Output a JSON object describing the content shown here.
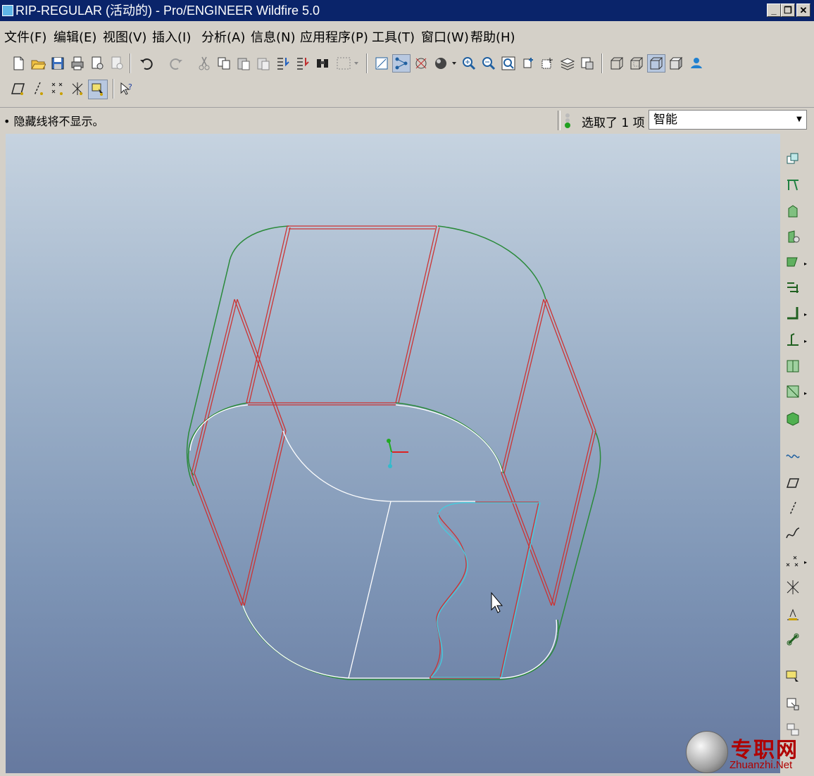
{
  "window": {
    "title": "RIP-REGULAR (活动的) - Pro/ENGINEER Wildfire 5.0",
    "minimize": "_",
    "restore": "❐",
    "close": "✕"
  },
  "menu": [
    {
      "label": "文件(F)"
    },
    {
      "label": "编辑(E)"
    },
    {
      "label": "视图(V)"
    },
    {
      "label": "插入(I)"
    },
    {
      "label": "分析(A)"
    },
    {
      "label": "信息(N)"
    },
    {
      "label": "应用程序(P)"
    },
    {
      "label": "工具(T)"
    },
    {
      "label": "窗口(W)"
    },
    {
      "label": "帮助(H)"
    }
  ],
  "message_bar": {
    "message": "• 隐藏线将不显示。",
    "selection_count_text": "选取了 1 项",
    "filter_value": "智能"
  },
  "toolbar_icons_row1": [
    "new-icon",
    "open-icon",
    "save-icon",
    "print-icon",
    "send-mail-icon",
    "send-icon",
    "undo-icon",
    "redo-icon",
    "cut-icon",
    "copy-icon",
    "paste-icon",
    "paste-special-icon",
    "regenerate-icon",
    "regen-manager-icon",
    "find-icon",
    "select-box-icon",
    "datum-display-icon",
    "network-icon",
    "spin-center-icon",
    "shading-icon",
    "zoom-in-icon",
    "zoom-out-icon",
    "refit-icon",
    "reorient-icon",
    "saved-views-icon",
    "layers-icon",
    "view-manager-icon",
    "wireframe-icon",
    "hidden-line-icon",
    "no-hidden-icon",
    "shaded-icon",
    "enhanced-realism-icon"
  ],
  "toolbar_icons_row2": [
    "datum-planes-icon",
    "datum-axes-icon",
    "datum-points-icon",
    "csys-icon",
    "annotations-icon",
    "context-help-icon"
  ],
  "right_toolbar_icons": [
    "assemble-icon",
    "datum-plane-tool-icon",
    "extrude-icon",
    "revolve-icon",
    "sweep-icon",
    "sweep-blend-icon",
    "hole-icon",
    "round-icon",
    "chamfer-icon",
    "draft-icon",
    "shell-icon",
    "rib-icon",
    "sketch-icon",
    "plane-icon",
    "axis-icon",
    "curve-icon",
    "point-icon",
    "csys-tool-icon",
    "analysis-icon",
    "mirror-icon",
    "annotation-feature-icon",
    "group-icon",
    "copy-paste-icon"
  ],
  "watermark": {
    "cn": "专职网",
    "en": "Zhuanzhi.Net"
  },
  "colors": {
    "titlebar": "#0a246a",
    "viewport_top": "#c6d3e0",
    "viewport_bottom": "#66799f",
    "edge_red": "#cc3333",
    "edge_green": "#2a8a3a",
    "edge_white": "#ffffff",
    "edge_cyan": "#44ccdd"
  }
}
